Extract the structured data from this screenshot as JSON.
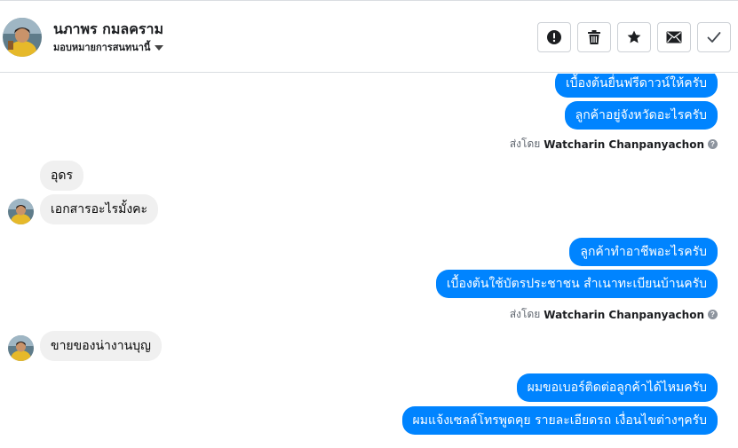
{
  "header": {
    "contact_name": "นภาพร กมลคราม",
    "assign_label": "มอบหมายการสนทนานี้"
  },
  "actions": [
    {
      "name": "mark-spam-button",
      "icon": "exclamation-circle-icon"
    },
    {
      "name": "delete-button",
      "icon": "trash-icon"
    },
    {
      "name": "star-button",
      "icon": "star-icon"
    },
    {
      "name": "mark-unread-button",
      "icon": "envelope-icon"
    },
    {
      "name": "mark-done-button",
      "icon": "checkmark-icon"
    }
  ],
  "messages": {
    "m1": "เบื้องต้นยื่นฟรีดาวน์ให้ครับ",
    "m2": "ลูกค้าอยู่จังหวัดอะไรครับ",
    "sent_by_1": {
      "prefix": "ส่งโดย",
      "agent": "Watcharin Chanpanyachon"
    },
    "m3": "อุดร",
    "m4": "เอกสารอะไรมั้งคะ",
    "m5": "ลูกค้าทำอาชีพอะไรครับ",
    "m6": "เบื้องต้นใช้บัตรประชาชน สำเนาทะเบียนบ้านครับ",
    "sent_by_2": {
      "prefix": "ส่งโดย",
      "agent": "Watcharin Chanpanyachon"
    },
    "m7": "ขายของน่างานบุญ",
    "m8": "ผมขอเบอร์ติดต่อลูกค้าได้ไหมครับ",
    "m9": "ผมแจ้งเซลล์โทรพูดคุย รายละเอียดรถ เงื่อนไขต่างๆครับ"
  },
  "colors": {
    "outgoing_bubble": "#0084ff",
    "incoming_bubble": "#f0f0f0",
    "border": "#dadde1"
  }
}
